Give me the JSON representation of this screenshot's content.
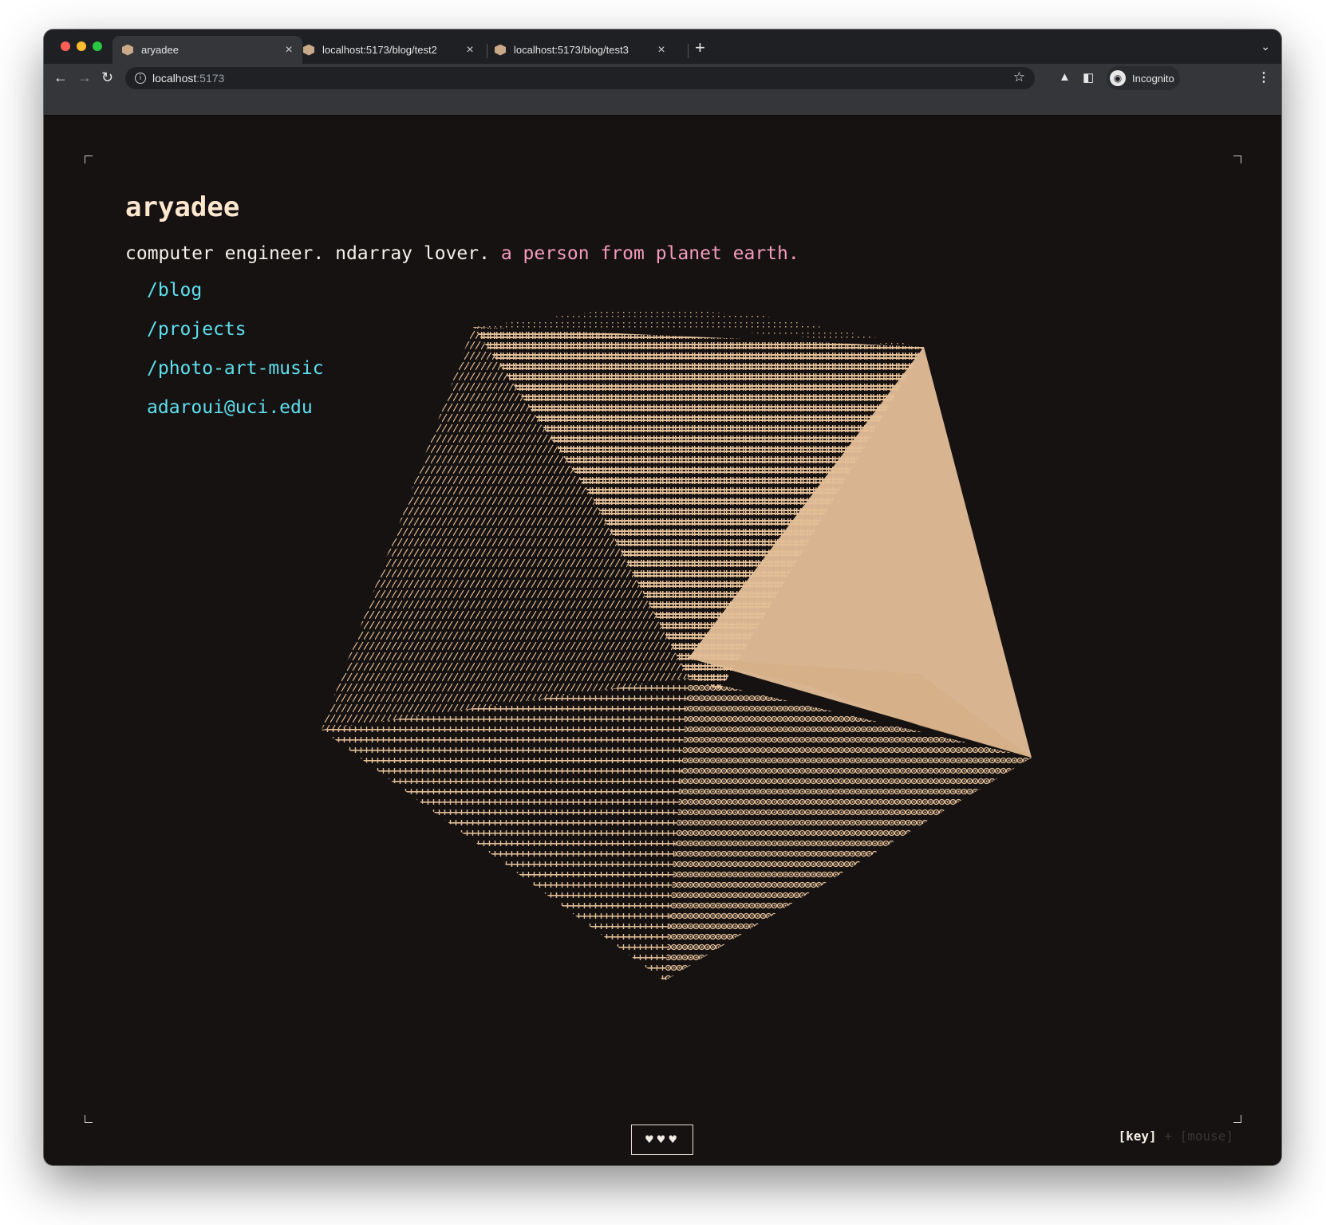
{
  "browser": {
    "tabs": [
      {
        "label": "aryadee",
        "active": true
      },
      {
        "label": "localhost:5173/blog/test2",
        "active": false
      },
      {
        "label": "localhost:5173/blog/test3",
        "active": false
      }
    ],
    "new_tab_icon": "plus-icon",
    "address": {
      "host": "localhost",
      "port": ":5173"
    },
    "profile_label": "Incognito"
  },
  "page": {
    "title": "aryadee",
    "tagline_plain": "computer engineer. ndarray lover.",
    "tagline_accent": "a person from planet earth.",
    "links": [
      {
        "label": "/blog"
      },
      {
        "label": "/projects"
      },
      {
        "label": "/photo-art-music"
      },
      {
        "label": "adaroui@uci.edu"
      }
    ],
    "hearts": "♥♥♥",
    "mode_key": "[key]",
    "mode_sep": "+",
    "mode_mouse": "[mouse]"
  },
  "colors": {
    "background": "#161212",
    "title": "#fde7cf",
    "accent_pink": "#f49bbd",
    "link_cyan": "#5ee0ee",
    "ascii_tan": "#e3bf98"
  },
  "art": {
    "type": "ascii-rendered-3d-solid",
    "glyphs": [
      ".",
      ":",
      "-",
      "/",
      "#",
      "+",
      "@",
      "e"
    ]
  }
}
